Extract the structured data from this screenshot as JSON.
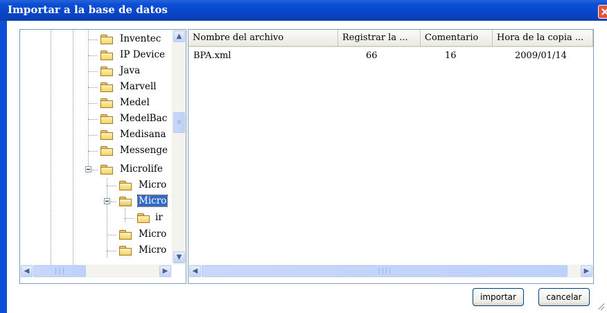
{
  "window": {
    "title": "Importar a la base de datos"
  },
  "tree": {
    "items": [
      {
        "label": "Inventec",
        "level": 2
      },
      {
        "label": "IP Device",
        "level": 2
      },
      {
        "label": "Java",
        "level": 2
      },
      {
        "label": "Marvell",
        "level": 2
      },
      {
        "label": "Medel",
        "level": 2
      },
      {
        "label": "MedelBac",
        "level": 2
      },
      {
        "label": "Medisana",
        "level": 2
      },
      {
        "label": "Messenge",
        "level": 2
      },
      {
        "label": "Microlife",
        "level": 2,
        "expanded": true
      },
      {
        "label": "Micro",
        "level": 3
      },
      {
        "label": "Micro",
        "level": 3,
        "expanded": true,
        "selected": true
      },
      {
        "label": "ir",
        "level": 4
      },
      {
        "label": "Micro",
        "level": 3
      },
      {
        "label": "Micro",
        "level": 3
      }
    ]
  },
  "list": {
    "columns": [
      "Nombre del archivo",
      "Registrar la ...",
      "Comentario",
      "Hora de la copia ..."
    ],
    "rows": [
      {
        "name": "BPA.xml",
        "records": "66",
        "comment": "16",
        "time": "2009/01/14"
      }
    ]
  },
  "buttons": {
    "import": "importar",
    "cancel": "cancelar"
  },
  "icons": [
    "folder-icon",
    "close-icon",
    "scroll-up-icon",
    "scroll-down-icon",
    "scroll-left-icon",
    "scroll-right-icon",
    "expander-minus-icon",
    "resize-grip-icon"
  ]
}
